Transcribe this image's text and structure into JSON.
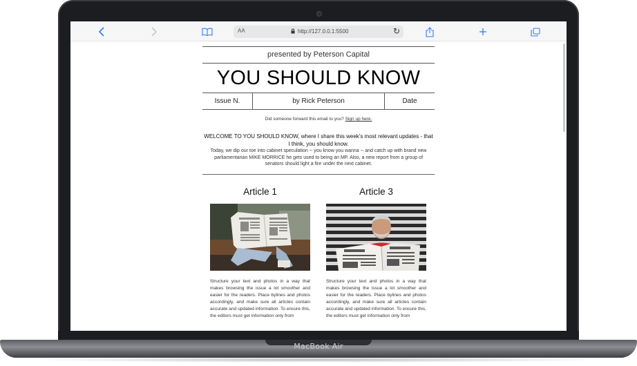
{
  "device": {
    "label": "MacBook Air"
  },
  "browser": {
    "text_size_label": "AA",
    "url": "http://127.0.0.1:5500",
    "icons": [
      "back-icon",
      "forward-icon",
      "reader-icon",
      "lock-icon",
      "reload-icon",
      "share-icon",
      "new-tab-icon",
      "tabs-icon"
    ]
  },
  "newsletter": {
    "presented": "presented by Peterson Capital",
    "title": "YOU SHOULD KNOW",
    "issue": "Issue N.",
    "author": "by Rick Peterson",
    "date": "Date",
    "forward_text": "Did someone forward this email to you?",
    "forward_link": "Sign up here.",
    "welcome": "WELCOME TO YOU SHOULD KNOW, where I share this week's most relevant updates - that I think, you should know.",
    "intro": "Today, we dip our toe into cabinet speculation -- you know you wanna -- and catch up with brand new parliamentarian MIKE MORRICE he gets used to being an MP. Also, a new report from a group of senators should light a fire under the next cabinet.",
    "articles": [
      {
        "title": "Article 1",
        "text": "Structure your text and photos in a way that makes browsing the issue a lot smoother and easier for the readers. Place bylines and photos accordingly, and make sure all articles contain accurate and updated information. To ensure this, the editors must get information only from"
      },
      {
        "title": "Article 3",
        "text": "Structure your text and photos in a way that makes browsing the issue a lot smoother and easier for the readers. Place bylines and photos accordingly, and make sure all articles contain accurate and updated information. To ensure this, the editors must get information only from"
      }
    ]
  },
  "colors": {
    "accent": "#2f7df6",
    "frame": "#1c1d20",
    "rule": "#555555"
  }
}
